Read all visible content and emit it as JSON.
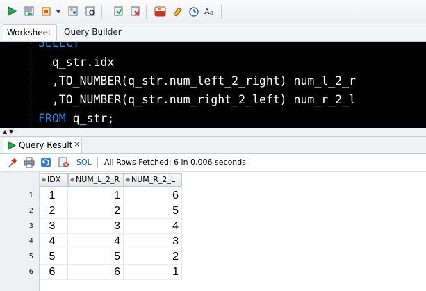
{
  "toolbar": {
    "icons": [
      "run-statement-icon",
      "run-script-icon",
      "autotrace-icon",
      "dropdown-icon",
      "explain-plan-icon",
      "sql-tuning-icon",
      "commit-icon",
      "rollback-icon",
      "sql-history-icon",
      "clear-icon",
      "history-clock-icon",
      "to-upper-case-icon"
    ]
  },
  "tabs": [
    {
      "label": "Worksheet"
    },
    {
      "label": "Query Builder"
    }
  ],
  "editor": {
    "lines": [
      {
        "kw": "SELECT",
        "text": ""
      },
      {
        "kw": "",
        "text": "  q_str.idx"
      },
      {
        "kw": "",
        "text": "  ,TO_NUMBER(q_str.num_left_2_right) num_l_2_r"
      },
      {
        "kw": "",
        "text": "  ,TO_NUMBER(q_str.num_right_2_left) num_r_2_l"
      },
      {
        "kw": "FROM",
        "text": " q_str;"
      }
    ]
  },
  "result": {
    "tab_label": "Query Result",
    "close_glyph": "×",
    "sql_label": "SQL",
    "fetch_text": "All Rows Fetched: 6 in 0.006 seconds",
    "columns": [
      "IDX",
      "NUM_L_2_R",
      "NUM_R_2_L"
    ],
    "rows": [
      {
        "n": "1",
        "c": [
          "1",
          "1",
          "6"
        ]
      },
      {
        "n": "2",
        "c": [
          "2",
          "2",
          "5"
        ]
      },
      {
        "n": "3",
        "c": [
          "3",
          "3",
          "4"
        ]
      },
      {
        "n": "4",
        "c": [
          "4",
          "4",
          "3"
        ]
      },
      {
        "n": "5",
        "c": [
          "5",
          "5",
          "2"
        ]
      },
      {
        "n": "6",
        "c": [
          "6",
          "6",
          "1"
        ]
      }
    ]
  }
}
